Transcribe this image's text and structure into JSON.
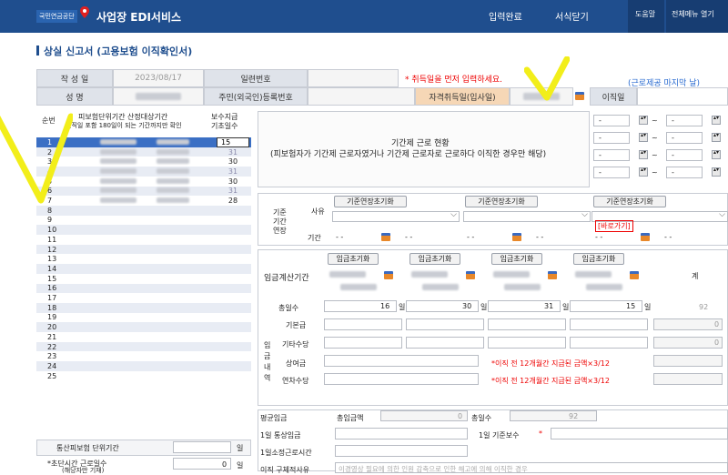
{
  "header": {
    "logo": "국민연금공단",
    "app_title": "사업장 EDI서비스",
    "btn_complete": "입력완료",
    "btn_close": "서식닫기",
    "btn_help": "도움말",
    "btn_menu": "전체메뉴 열기"
  },
  "page_title": "상실 신고서 (고용보험 이직확인서)",
  "info": {
    "author_label": "작 성 일",
    "author_date": "2023/08/17",
    "serial_label": "일련번호",
    "warning": "* 취득일을 먼저 입력하세요.",
    "note": "(근로제공 마지막 날)",
    "name_label": "성 명",
    "rrn_label": "주민(외국인)등록번호",
    "acq_label": "자격취득일(입사일)",
    "leave_label": "이직일"
  },
  "period": {
    "no_label": "순번",
    "col1_label": "피보험단위기간 산정대상기간",
    "col1_sub": "이직일 포함 180일이 되는 기간까지만 확인",
    "col2_label": "보수지급",
    "col2_sub": "기초일수",
    "rows": [
      {
        "no": "1",
        "days": "15"
      },
      {
        "no": "2",
        "days": "31"
      },
      {
        "no": "3",
        "days": "30"
      },
      {
        "no": "4",
        "days": "31"
      },
      {
        "no": "5",
        "days": "30"
      },
      {
        "no": "6",
        "days": "31"
      },
      {
        "no": "7",
        "days": "28"
      },
      {
        "no": "8",
        "days": ""
      },
      {
        "no": "9",
        "days": ""
      },
      {
        "no": "10",
        "days": ""
      },
      {
        "no": "11",
        "days": ""
      },
      {
        "no": "12",
        "days": ""
      },
      {
        "no": "13",
        "days": ""
      },
      {
        "no": "14",
        "days": ""
      },
      {
        "no": "15",
        "days": ""
      },
      {
        "no": "16",
        "days": ""
      },
      {
        "no": "17",
        "days": ""
      },
      {
        "no": "18",
        "days": ""
      },
      {
        "no": "19",
        "days": ""
      },
      {
        "no": "20",
        "days": ""
      },
      {
        "no": "21",
        "days": ""
      },
      {
        "no": "22",
        "days": ""
      },
      {
        "no": "23",
        "days": ""
      },
      {
        "no": "24",
        "days": ""
      },
      {
        "no": "25",
        "days": ""
      }
    ],
    "total_label": "통산피보험 단위기간",
    "total_unit": "일",
    "short_label": "*초단시간 근로일수",
    "short_sub": "(해당자만 기재)",
    "short_value": "0",
    "short_unit": "일"
  },
  "contract": {
    "title": "기간제 근로 현황",
    "desc": "(피보험자가 기간제 근로자였거나 기간제 근로자로 근로하다 이직한 경우만 해당)",
    "dash": "-",
    "tilde": "~"
  },
  "std": {
    "label1": "기준",
    "label2": "기간",
    "label3": "연장",
    "reason_label": "사유",
    "period_label": "기간",
    "reset_btn": "기준연장초기화",
    "shortcut": "[바로가기]",
    "dash": "- -"
  },
  "wage": {
    "calc_label": "임금계산기간",
    "reset_btn": "임금초기화",
    "total_label": "계",
    "days_label": "총일수",
    "days": [
      "16",
      "30",
      "31",
      "15"
    ],
    "day_unit": "일",
    "total_days": "92",
    "side_label": "임금내역",
    "basic_label": "기본급",
    "other_label": "기타수당",
    "bonus_label": "상여금",
    "annual_label": "연차수당",
    "hint": "*이직 전 12개월간 지급된 금액×3/12",
    "zero": "0"
  },
  "avg": {
    "label": "평균임금",
    "total_pay_label": "총임금액",
    "total_pay": "0",
    "total_days_label": "총일수",
    "total_days": "92",
    "daily_label": "1일 통상임금",
    "daily_base_label": "1일 기준보수",
    "star": "*",
    "hours_label": "1일소정근로시간",
    "reason_label": "이직 구체적사유",
    "reason_placeholder": "이경영상 필요에 의한 인원 감축으로 인한 해고에 의해 이직한 경우"
  }
}
